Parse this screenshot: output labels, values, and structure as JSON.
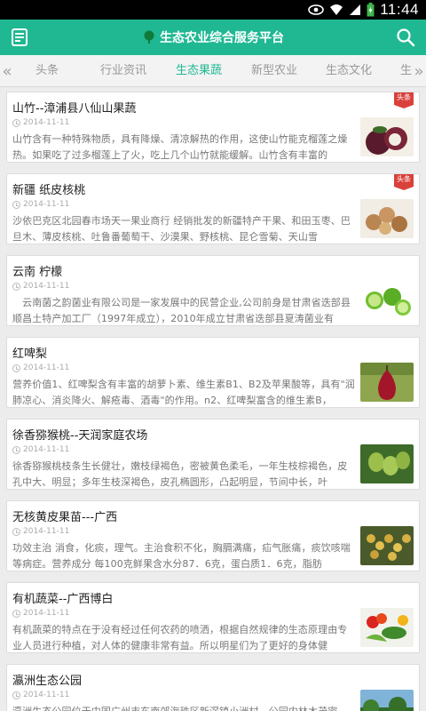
{
  "status": {
    "time": "11:44"
  },
  "header": {
    "title": "生态农业综合服务平台"
  },
  "tabs": [
    "头条",
    "行业资讯",
    "生态果蔬",
    "新型农业",
    "生态文化",
    "生态"
  ],
  "active_tab": "生态果蔬",
  "badge_label": "头条",
  "articles": [
    {
      "title": "山竹--漳浦县八仙山果蔬",
      "date": "2014-11-11",
      "body": "山竹含有一种特殊物质，具有降燥、清凉解热的作用，这使山竹能克榴莲之燥热。如果吃了过多榴莲上了火，吃上几个山竹就能缓解。山竹含有丰富的",
      "thumb": "mangosteen-image",
      "badge": true
    },
    {
      "title": "新疆 纸皮核桃",
      "date": "2014-11-11",
      "body": "沙依巴克区北园春市场天一果业商行 经销批发的新疆特产干果、和田玉枣、巴旦木、薄皮核桃、吐鲁番葡萄干、沙漠果、野核桃、昆仑雪菊、天山雪",
      "thumb": "walnut-image",
      "badge": true
    },
    {
      "title": "云南 柠檬",
      "date": "2014-11-11",
      "body": "　云南菌之韵菌业有限公司是一家发展中的民营企业,公司前身是甘肃省迭部县顺昌土特产加工厂（1997年成立），2010年成立甘肃省迭部县夏涛菌业有",
      "thumb": "lime-image",
      "badge": false
    },
    {
      "title": "红啤梨",
      "date": "2014-11-11",
      "body": "营养价值1、红啤梨含有丰富的胡萝卜素、维生素B1、B2及苹果酸等，具有\"润肺凉心、消炎降火、解疮毒、酒毒\"的作用。n2、红啤梨富含的维生素B，",
      "thumb": "red-pear-image",
      "badge": false
    },
    {
      "title": "徐香猕猴桃--天润家庭农场",
      "date": "2014-11-11",
      "body": "徐香猕猴桃枝条生长健壮，嫩枝绿褐色，密被黄色柔毛，一年生枝棕褐色，皮孔中大、明显；多年生枝深褐色，皮孔椭圆形，凸起明显，节间中长，叶",
      "thumb": "kiwi-image",
      "badge": false
    },
    {
      "title": "无核黄皮果苗---广西",
      "date": "2014-11-11",
      "body": "功效主治 消食，化痰，理气。主治食积不化，胸膈满痛，疝气胀痛，痰饮咳喘等病症。营养成分 每100克鲜果含水分87．6克，蛋白质1．6克，脂肪",
      "thumb": "wampee-image",
      "badge": false
    },
    {
      "title": "有机蔬菜--广西博白",
      "date": "2014-11-11",
      "body": "有机蔬菜的特点在于没有经过任何农药的喷洒，根据自然规律的生态原理由专业人员进行种植，对人体的健康非常有益。所以明星们为了更好的身体健",
      "thumb": "vegetables-image",
      "badge": false
    },
    {
      "title": "瀛洲生态公园",
      "date": "2014-11-11",
      "body": "瀛洲生态公园位于中国广州市东南郊海珠区新滘镇小洲村。公园内林木茂密，",
      "thumb": "park-image",
      "badge": false
    }
  ]
}
